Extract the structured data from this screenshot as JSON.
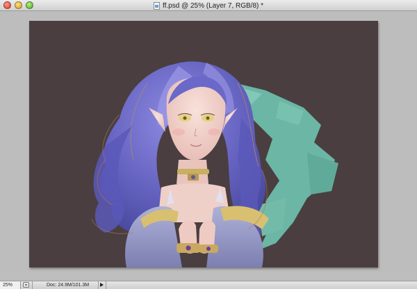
{
  "window": {
    "title": "ff.psd @ 25% (Layer 7, RGB/8) *"
  },
  "statusbar": {
    "zoom": "25%",
    "doc_info": "Doc: 24.9M/101.3M"
  },
  "icons": {
    "close": "close-window-icon",
    "minimize": "minimize-window-icon",
    "zoom": "zoom-window-icon",
    "document": "psd-document-icon",
    "status": "status-bar-icon",
    "menu": "triangle-right-icon"
  },
  "colors": {
    "artboard_bg": "#4a3e40",
    "hair": "#6f6dc8",
    "teal_strokes": "#6fc3b0",
    "skin": "#f2d2cc",
    "gold": "#d8c070"
  }
}
